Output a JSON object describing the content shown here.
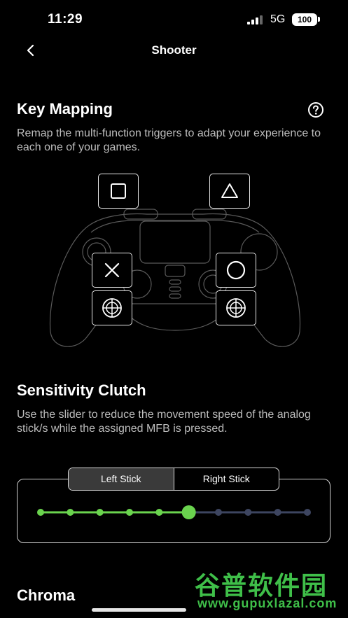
{
  "status_bar": {
    "time": "11:29",
    "network": "5G",
    "battery": "100"
  },
  "nav": {
    "title": "Shooter",
    "back_icon": "chevron-left-icon"
  },
  "key_mapping": {
    "title": "Key Mapping",
    "description": "Remap the multi-function triggers to adapt your experience to each one of your games.",
    "help_icon": "question-circle-icon",
    "buttons": [
      "square-icon",
      "triangle-icon",
      "cross-icon",
      "circle-icon",
      "left-stick-icon",
      "right-stick-icon"
    ]
  },
  "sensitivity": {
    "title": "Sensitivity Clutch",
    "description": "Use the slider to reduce the movement speed of the analog stick/s while the assigned MFB is pressed.",
    "tabs": [
      {
        "label": "Left Stick",
        "active": true
      },
      {
        "label": "Right Stick",
        "active": false
      }
    ],
    "slider": {
      "steps": 10,
      "selected_step": 6,
      "active_color": "#6ad34e",
      "inactive_color": "#3d4560"
    }
  },
  "next_section": {
    "title": "Chroma"
  },
  "watermark": {
    "cn": "谷普软件园",
    "url": "www.gupuxlazal.com"
  }
}
